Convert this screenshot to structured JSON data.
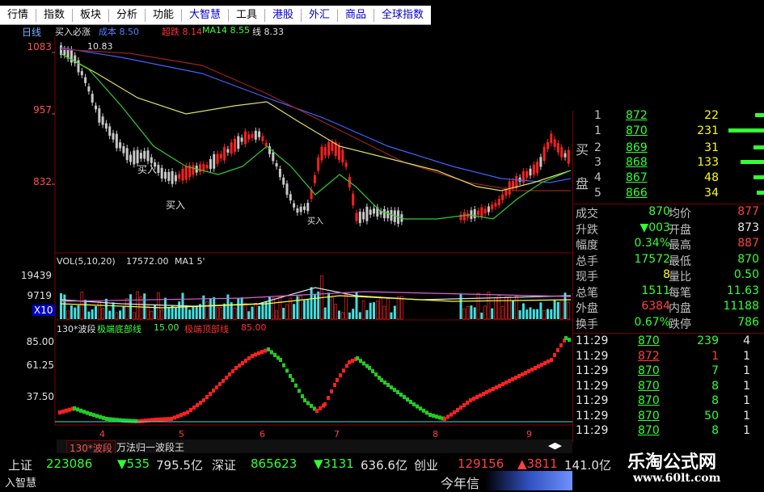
{
  "menu": [
    "行情",
    "指数",
    "板块",
    "分析",
    "功能",
    "大智慧",
    "工具",
    "港股",
    "外汇",
    "商品",
    "全球指数"
  ],
  "chart": {
    "period_label": "日线",
    "header": {
      "t1": "买入必涨",
      "t2": "成本 8.50",
      "t3": "超跌 8.14",
      "t4": "MA14 8.55",
      "t5": "线 8.33"
    },
    "price_axis": [
      "1083",
      "957",
      "832"
    ],
    "high_marker": "10.83",
    "buy_labels": [
      "买入",
      "买入",
      "买入"
    ],
    "vol_header": {
      "t1": "VOL(5,10,20)",
      "t2": "17572.00",
      "t3": "MA1 5'"
    },
    "vol_axis": [
      "19439",
      "9719",
      "X10"
    ],
    "ind_header": {
      "t1": "130*波段",
      "t2": "极端底部线",
      "t3": "15.00",
      "t4": "极端顶部线",
      "t5": "85.00"
    },
    "ind_axis": [
      "85.00",
      "61.25",
      "37.50"
    ],
    "date_ticks": [
      "4",
      "5",
      "6",
      "7",
      "8",
      "9"
    ]
  },
  "tabs": {
    "t1": "130*波段",
    "t2": "万法归一波段王"
  },
  "quote": {
    "side_buy": "买",
    "side_pan": "盘",
    "book": [
      {
        "lvl": "1",
        "price": "872",
        "vol": "22"
      },
      {
        "lvl": "1",
        "price": "870",
        "vol": "231"
      },
      {
        "lvl": "2",
        "price": "869",
        "vol": "31"
      },
      {
        "lvl": "3",
        "price": "868",
        "vol": "133"
      },
      {
        "lvl": "4",
        "price": "867",
        "vol": "48"
      },
      {
        "lvl": "5",
        "price": "866",
        "vol": "34"
      }
    ],
    "stats": [
      {
        "l1": "成交",
        "v1": "870",
        "l2": "均价",
        "v2": "877"
      },
      {
        "l1": "升跌",
        "v1": "▼003",
        "l2": "开盘",
        "v2": "873"
      },
      {
        "l1": "幅度",
        "v1": "0.34%",
        "l2": "最高",
        "v2": "887"
      },
      {
        "l1": "总手",
        "v1": "17572",
        "l2": "最低",
        "v2": "870"
      },
      {
        "l1": "现手",
        "v1": "8",
        "l2": "量比",
        "v2": "0.50"
      },
      {
        "l1": "总笔",
        "v1": "1511",
        "l2": "每笔",
        "v2": "11.63"
      },
      {
        "l1": "外盘",
        "v1": "6384",
        "l2": "内盘",
        "v2": "11188"
      },
      {
        "l1": "换手",
        "v1": "0.67%",
        "l2": "跌停",
        "v2": "786"
      }
    ],
    "ticks": [
      {
        "time": "11:29",
        "price": "870",
        "vol": "239",
        "n": "4"
      },
      {
        "time": "11:29",
        "price": "872",
        "vol": "1",
        "n": "1"
      },
      {
        "time": "11:29",
        "price": "870",
        "vol": "7",
        "n": "1"
      },
      {
        "time": "11:29",
        "price": "870",
        "vol": "8",
        "n": "1"
      },
      {
        "time": "11:29",
        "price": "870",
        "vol": "8",
        "n": "1"
      },
      {
        "time": "11:29",
        "price": "870",
        "vol": "50",
        "n": "1"
      },
      {
        "time": "11:29",
        "price": "870",
        "vol": "8",
        "n": "1"
      }
    ]
  },
  "index_bar": {
    "sh_label": "上证",
    "sh_val": "223086",
    "sh_chg": "▼535",
    "sh_amt": "795.5亿",
    "sz_label": "深证",
    "sz_val": "865623",
    "sz_chg": "▼3131",
    "sz_amt": "636.6亿",
    "cy_label": "创业",
    "cy_val": "129156",
    "cy_chg": "▲3811",
    "cy_amt": "141.0亿",
    "ticker": "今年信",
    "corner": "入智慧"
  },
  "watermark": {
    "line1": "乐淘公式网",
    "line2": "www.60lt.com"
  },
  "colors": {
    "up": "#ff2020",
    "down": "#00ffff",
    "green": "#33cc33",
    "ma_yellow": "#e0e060",
    "ma_blue": "#4060ff",
    "ma_red": "#a02020"
  }
}
